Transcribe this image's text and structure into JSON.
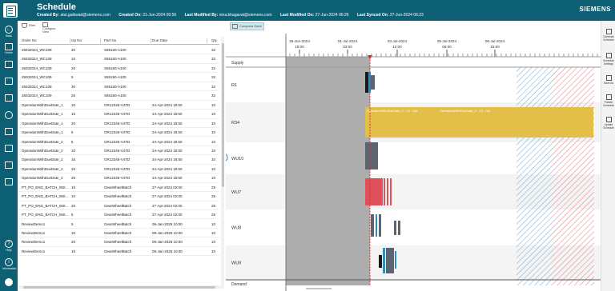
{
  "header": {
    "title": "Schedule",
    "brand": "SIEMENS",
    "meta": [
      {
        "label": "Created By:",
        "value": "atul.gaikwad@siemens.com"
      },
      {
        "label": "Created On:",
        "value": "21-Jun-2024 00:56"
      },
      {
        "label": "Last Modified By:",
        "value": "nina.bhagavat@siemens.com"
      },
      {
        "label": "Last Modified On:",
        "value": "27-Jun-2024 06:26"
      },
      {
        "label": "Last Synced On:",
        "value": "27-Jun-2024 06:23"
      }
    ]
  },
  "nav": [
    {
      "label": "Back"
    },
    {
      "label": "Home"
    },
    {
      "label": "Help"
    },
    {
      "label": "Information"
    }
  ],
  "toolbar": {
    "filter": "Filter",
    "configure": "Configure View",
    "compress": "Compress Gantt"
  },
  "table": {
    "columns": [
      "Order No",
      "Op No",
      "Part No",
      "Due Date",
      "Qty"
    ],
    "rows": [
      [
        "25032024_WC109",
        "40",
        "S55150-A100",
        "",
        "32"
      ],
      [
        "25032024_WC109",
        "10",
        "S55150-A100",
        "",
        "32"
      ],
      [
        "25032024_WC109",
        "20",
        "S55150-A100",
        "",
        "32"
      ],
      [
        "25032024_WC109",
        "5",
        "S55150-A100",
        "",
        "32"
      ],
      [
        "25032024_WC109",
        "30",
        "S55150-A100",
        "",
        "32"
      ],
      [
        "25032024_WC109",
        "25",
        "S55150-A100",
        "",
        "32"
      ],
      [
        "OperationWithDueDate_1",
        "10",
        "GR12345-V4TD",
        "24-Apr-2024 18:50",
        "10"
      ],
      [
        "OperationWithDueDate_1",
        "15",
        "GR12345-V4TD",
        "24-Apr-2024 18:50",
        "10"
      ],
      [
        "OperationWithDueDate_1",
        "20",
        "GR12345-V4TD",
        "24-Apr-2024 18:50",
        "10"
      ],
      [
        "OperationWithDueDate_1",
        "5",
        "GR12345-V4TD",
        "24-Apr-2024 18:50",
        "10"
      ],
      [
        "OperationWithDueDate_2",
        "5",
        "GR12345-V4TD",
        "24-Apr-2024 18:50",
        "10"
      ],
      [
        "OperationWithDueDate_2",
        "10",
        "GR12345-V4TD",
        "24-Apr-2024 18:50",
        "10"
      ],
      [
        "OperationWithDueDate_2",
        "15",
        "GR12345-V4TD",
        "24-Apr-2024 18:50",
        "10"
      ],
      [
        "OperationWithDueDate_2",
        "20",
        "GR12345-V4TD",
        "24-Apr-2024 18:50",
        "10"
      ],
      [
        "OperationWithDueDate_2",
        "25",
        "GR12345-V4TD",
        "24-Apr-2024 18:50",
        "10"
      ],
      [
        "PT_PO_ENG_BATCH_060...",
        "15",
        "GearWheelBatch",
        "27-Apr-2024 02:00",
        "25"
      ],
      [
        "PT_PO_ENG_BATCH_060...",
        "10",
        "GearWheelBatch",
        "27-Apr-2024 02:00",
        "25"
      ],
      [
        "PT_PO_ENG_BATCH_060...",
        "20",
        "GearWheelBatch",
        "27-Apr-2024 02:00",
        "25"
      ],
      [
        "PT_PO_ENG_BATCH_060...",
        "5",
        "GearWheelBatch",
        "27-Apr-2024 02:00",
        "25"
      ],
      [
        "ReviewDemo1",
        "5",
        "GearWheelBatch",
        "09-Jan-2025 10:00",
        "10"
      ],
      [
        "ReviewDemo1",
        "10",
        "GearWheelBatch",
        "09-Jan-2025 10:00",
        "10"
      ],
      [
        "ReviewDemo1",
        "20",
        "GearWheelBatch",
        "09-Jan-2025 10:00",
        "10"
      ],
      [
        "ReviewDemo1",
        "15",
        "GearWheelBatch",
        "09-Jan-2025 10:00",
        "10"
      ]
    ]
  },
  "gantt": {
    "dates": [
      {
        "date": "28-Jun-2024",
        "time": "18:00"
      },
      {
        "date": "01-Jul-2024",
        "time": "03:00"
      },
      {
        "date": "03-Jul-2024",
        "time": "12:00"
      },
      {
        "date": "05-Jul-2024",
        "time": "06:00"
      },
      {
        "date": "06-Jul-2024",
        "time": "15:00"
      }
    ],
    "supply_label": "Supply",
    "demand_label": "Demand",
    "resources": [
      "R1",
      "R34",
      "WU10",
      "WU7",
      "WU8",
      "WU9"
    ],
    "r34_bar_labels": [
      "OperationWithDueDate_2 · 10 · 0pt",
      "OperationWithDueDate_2 · 15 · 0pt"
    ],
    "colors": {
      "bar_yellow": "#e3bf4a",
      "bar_red": "#e0505a",
      "bar_blue": "#2f8fb4",
      "bar_gray": "#5c6470",
      "past": "#adadad"
    }
  },
  "rightbar": [
    "Generate Schedule",
    "Schedule Settings",
    "Save As",
    "Publish Schedule",
    "Update Schedule"
  ]
}
